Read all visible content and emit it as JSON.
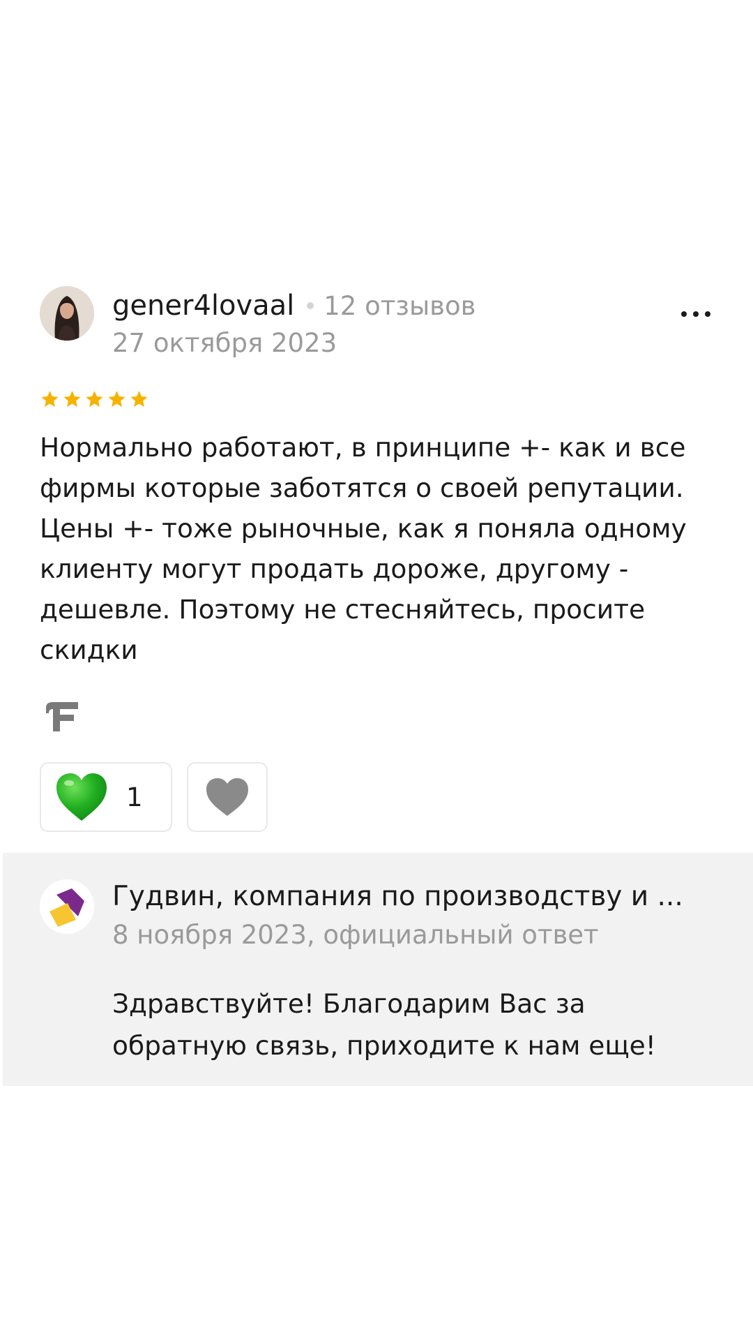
{
  "review": {
    "author": "gener4lovaal",
    "review_count": "12 отзывов",
    "date": "27 октября 2023",
    "rating": 5,
    "rating_color": "#f5b300",
    "text": "Нормально работают, в принципе +- как и все фирмы которые заботятся о своей репутации. Цены +- тоже рыночные, как я поняла одному клиенту могут продать дороже, другому - дешевле. Поэтому не стесняйтесь, просите скидки",
    "likes": "1",
    "icons": {
      "avatar": "user-avatar-photo",
      "more": "more-dots-icon",
      "source": "source-logo-icon",
      "like": "green-heart-icon",
      "dislike": "gray-heart-icon"
    }
  },
  "reply": {
    "company": "Гудвин, компания по производству и ...",
    "meta": "8 ноября 2023, официальный ответ",
    "text": "Здравствуйте! Благодарим Вас за обратную связь, приходите к нам еще!",
    "logo_colors": [
      "#7b2a8c",
      "#f7c531"
    ],
    "background": "#f2f2f2"
  }
}
